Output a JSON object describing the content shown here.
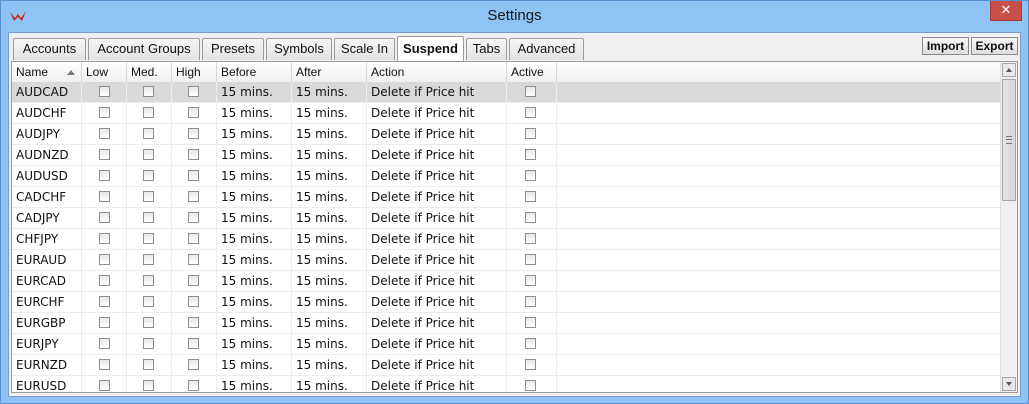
{
  "window": {
    "title": "Settings",
    "close_label": "✕"
  },
  "tabs": [
    {
      "label": "Accounts",
      "active": false
    },
    {
      "label": "Account Groups",
      "active": false
    },
    {
      "label": "Presets",
      "active": false
    },
    {
      "label": "Symbols",
      "active": false
    },
    {
      "label": "Scale In",
      "active": false
    },
    {
      "label": "Suspend",
      "active": true
    },
    {
      "label": "Tabs",
      "active": false
    },
    {
      "label": "Advanced",
      "active": false
    }
  ],
  "toolbar": {
    "import_label": "Import",
    "export_label": "Export"
  },
  "columns": [
    "Name",
    "Low",
    "Med.",
    "High",
    "Before",
    "After",
    "Action",
    "Active"
  ],
  "rows": [
    {
      "name": "AUDCAD",
      "before": "15 mins.",
      "after": "15 mins.",
      "action": "Delete if Price hit",
      "selected": true
    },
    {
      "name": "AUDCHF",
      "before": "15 mins.",
      "after": "15 mins.",
      "action": "Delete if Price hit"
    },
    {
      "name": "AUDJPY",
      "before": "15 mins.",
      "after": "15 mins.",
      "action": "Delete if Price hit"
    },
    {
      "name": "AUDNZD",
      "before": "15 mins.",
      "after": "15 mins.",
      "action": "Delete if Price hit"
    },
    {
      "name": "AUDUSD",
      "before": "15 mins.",
      "after": "15 mins.",
      "action": "Delete if Price hit"
    },
    {
      "name": "CADCHF",
      "before": "15 mins.",
      "after": "15 mins.",
      "action": "Delete if Price hit"
    },
    {
      "name": "CADJPY",
      "before": "15 mins.",
      "after": "15 mins.",
      "action": "Delete if Price hit"
    },
    {
      "name": "CHFJPY",
      "before": "15 mins.",
      "after": "15 mins.",
      "action": "Delete if Price hit"
    },
    {
      "name": "EURAUD",
      "before": "15 mins.",
      "after": "15 mins.",
      "action": "Delete if Price hit"
    },
    {
      "name": "EURCAD",
      "before": "15 mins.",
      "after": "15 mins.",
      "action": "Delete if Price hit"
    },
    {
      "name": "EURCHF",
      "before": "15 mins.",
      "after": "15 mins.",
      "action": "Delete if Price hit"
    },
    {
      "name": "EURGBP",
      "before": "15 mins.",
      "after": "15 mins.",
      "action": "Delete if Price hit"
    },
    {
      "name": "EURJPY",
      "before": "15 mins.",
      "after": "15 mins.",
      "action": "Delete if Price hit"
    },
    {
      "name": "EURNZD",
      "before": "15 mins.",
      "after": "15 mins.",
      "action": "Delete if Price hit"
    },
    {
      "name": "EURUSD",
      "before": "15 mins.",
      "after": "15 mins.",
      "action": "Delete if Price hit"
    }
  ],
  "icons": {
    "app": "app-logo-icon",
    "sort": "sort-ascending-icon",
    "close": "close-icon"
  },
  "colors": {
    "titlebar": "#8fc3f5",
    "close": "#c7514a",
    "selected_row": "#d9d9d9"
  }
}
